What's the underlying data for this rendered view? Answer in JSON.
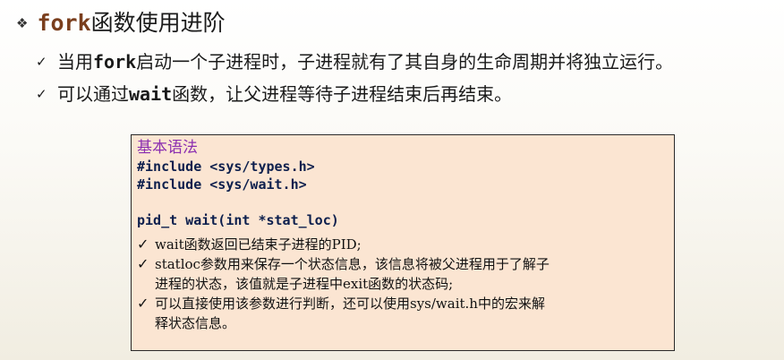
{
  "title": {
    "bullet": "❖",
    "keyword": "fork",
    "rest": "函数使用进阶"
  },
  "bullets": [
    {
      "mark": "✓",
      "pre": "当用",
      "code": "fork",
      "post": "启动一个子进程时，子进程就有了其自身的生命周期并将独立运行。"
    },
    {
      "mark": "✓",
      "pre": "可以通过",
      "code": "wait",
      "post": "函数，让父进程等待子进程结束后再结束。"
    }
  ],
  "box": {
    "header": "基本语法",
    "code_lines": [
      "#include <sys/types.h>",
      "#include <sys/wait.h>",
      "",
      "pid_t wait(int *stat_loc)"
    ],
    "notes": [
      {
        "mark": "✓",
        "text": "wait函数返回已结束子进程的PID;"
      },
      {
        "mark": "✓",
        "text": "statloc参数用来保存一个状态信息，该信息将被父进程用于了解子\n进程的状态，该值就是子进程中exit函数的状态码;"
      },
      {
        "mark": "✓",
        "text": "可以直接使用该参数进行判断，还可以使用sys/wait.h中的宏来解\n释状态信息。"
      }
    ]
  }
}
